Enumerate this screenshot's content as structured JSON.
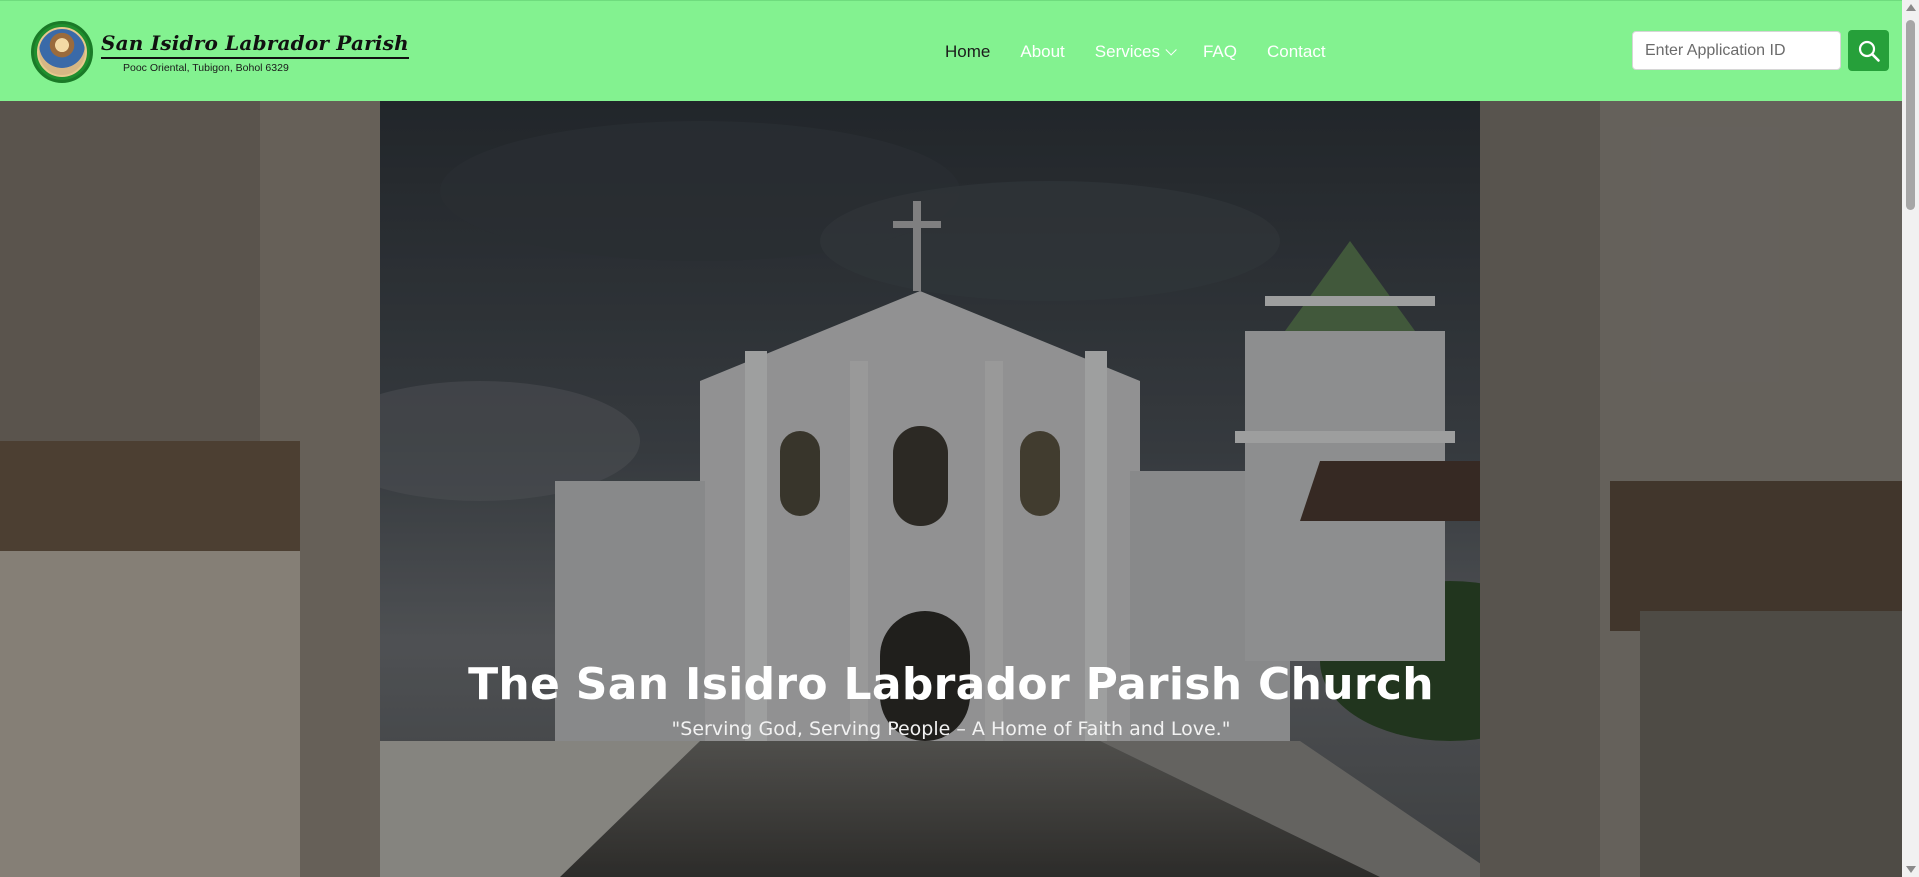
{
  "brand": {
    "title": "San Isidro Labrador Parish",
    "address": "Pooc Oriental, Tubigon, Bohol 6329"
  },
  "nav": {
    "items": [
      {
        "label": "Home"
      },
      {
        "label": "About"
      },
      {
        "label": "Services"
      },
      {
        "label": "FAQ"
      },
      {
        "label": "Contact"
      }
    ]
  },
  "search": {
    "placeholder": "Enter Application ID",
    "button_icon": "search-icon"
  },
  "hero": {
    "title": "The San Isidro Labrador Parish Church",
    "tagline": "\"Serving God, Serving People – A Home of Faith and Love.\""
  },
  "colors": {
    "navbar": "#83f290",
    "search_button": "#26a03a",
    "active_link": "#1b1b1b",
    "link": "#ffffff"
  }
}
